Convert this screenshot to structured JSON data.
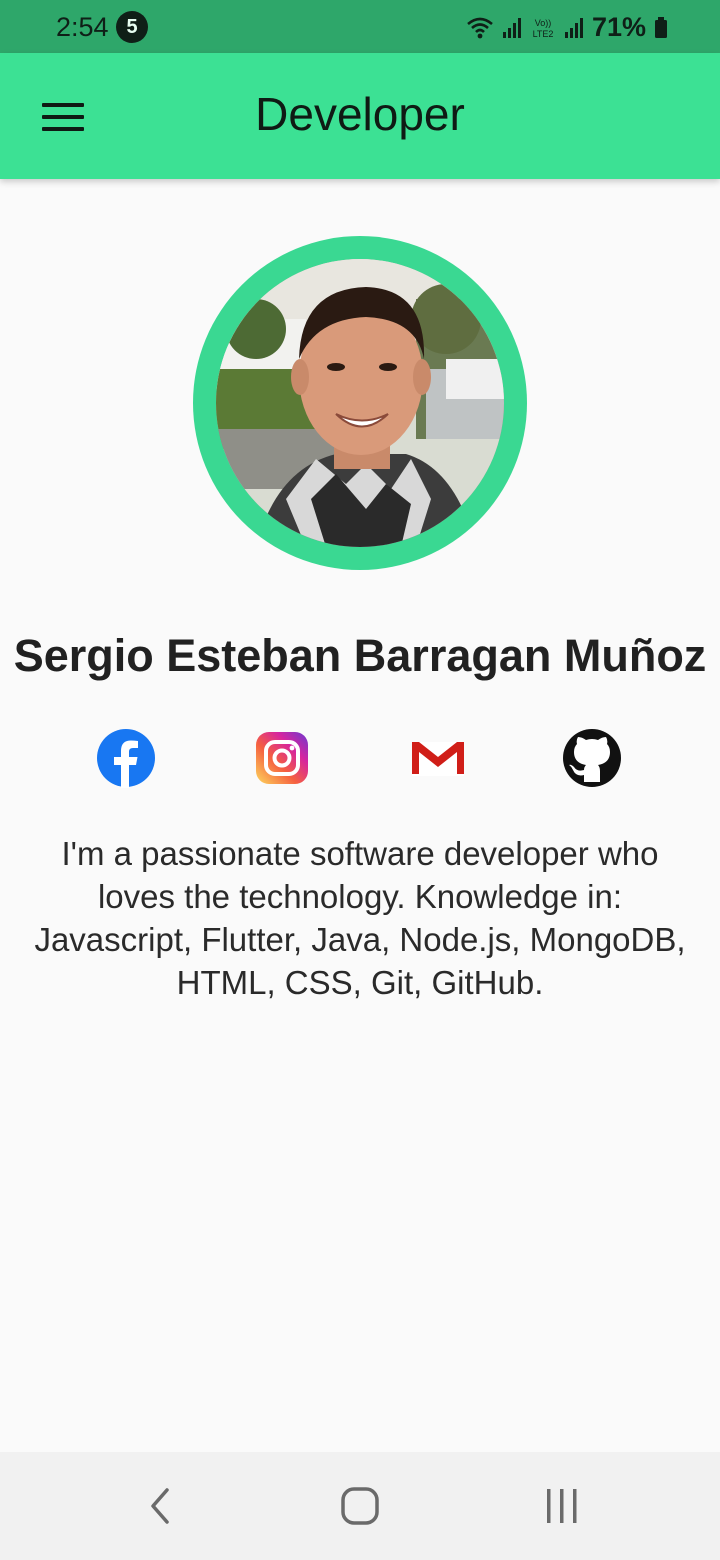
{
  "status_bar": {
    "time": "2:54",
    "notification_count": "5",
    "network_label": "Vo) LTE2",
    "battery_percent": "71%",
    "icons": [
      "wifi-icon",
      "signal-icon",
      "volte-icon",
      "signal-icon",
      "battery-icon"
    ]
  },
  "app_bar": {
    "title": "Developer",
    "menu_icon": "menu-icon",
    "color": "#3ce194"
  },
  "profile": {
    "name": "Sergio Esteban Barragan Muñoz",
    "avatar_ring_color": "#3ad892",
    "bio": "I'm a passionate software developer who loves the technology. Knowledge in: Javascript, Flutter, Java, Node.js, MongoDB, HTML, CSS, Git, GitHub."
  },
  "social_links": [
    {
      "icon": "facebook-icon",
      "color": "#1877f2"
    },
    {
      "icon": "instagram-icon",
      "color": "#d6249f"
    },
    {
      "icon": "gmail-icon",
      "color": "#d01e18"
    },
    {
      "icon": "github-icon",
      "color": "#111111"
    }
  ],
  "nav_bar": {
    "icons": [
      "back-icon",
      "home-icon",
      "recents-icon"
    ]
  }
}
